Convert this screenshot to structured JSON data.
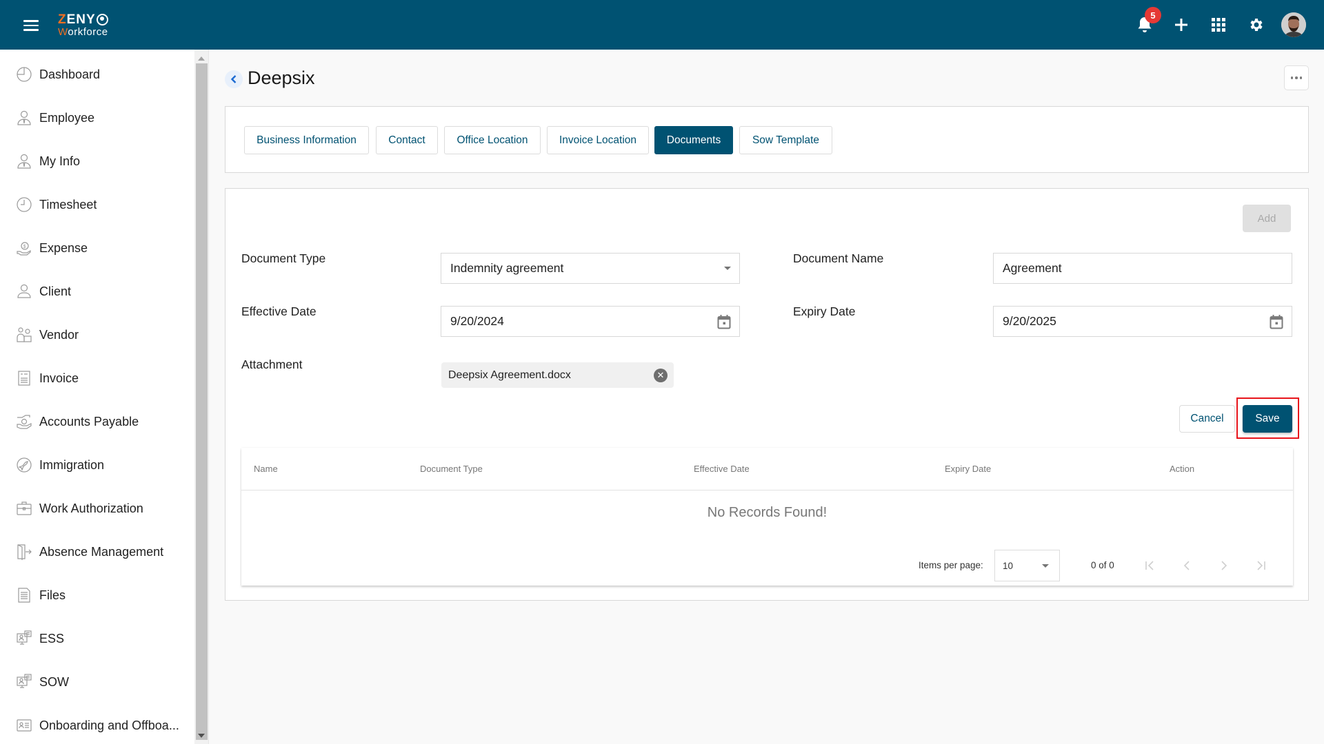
{
  "app": {
    "logo_line1_first": "Z",
    "logo_line1_rest": "ENY",
    "logo_line2_first": "W",
    "logo_line2_rest": "orkforce"
  },
  "header": {
    "notification_count": "5",
    "icons": [
      "menu-icon",
      "bell-icon",
      "plus-icon",
      "apps-grid-icon",
      "gear-icon",
      "user-avatar"
    ]
  },
  "sidebar": {
    "items": [
      {
        "label": "Dashboard",
        "icon": "dashboard-icon"
      },
      {
        "label": "Employee",
        "icon": "employee-icon"
      },
      {
        "label": "My Info",
        "icon": "my-info-icon"
      },
      {
        "label": "Timesheet",
        "icon": "clock-icon"
      },
      {
        "label": "Expense",
        "icon": "expense-icon"
      },
      {
        "label": "Client",
        "icon": "client-icon"
      },
      {
        "label": "Vendor",
        "icon": "vendor-icon"
      },
      {
        "label": "Invoice",
        "icon": "invoice-icon"
      },
      {
        "label": "Accounts Payable",
        "icon": "accounts-payable-icon"
      },
      {
        "label": "Immigration",
        "icon": "immigration-icon"
      },
      {
        "label": "Work Authorization",
        "icon": "briefcase-icon"
      },
      {
        "label": "Absence Management",
        "icon": "door-exit-icon"
      },
      {
        "label": "Files",
        "icon": "file-icon"
      },
      {
        "label": "ESS",
        "icon": "ess-icon"
      },
      {
        "label": "SOW",
        "icon": "sow-icon"
      },
      {
        "label": "Onboarding and Offboa...",
        "icon": "id-card-icon"
      }
    ]
  },
  "page": {
    "title": "Deepsix",
    "tabs": [
      {
        "label": "Business Information",
        "active": false
      },
      {
        "label": "Contact",
        "active": false
      },
      {
        "label": "Office Location",
        "active": false
      },
      {
        "label": "Invoice Location",
        "active": false
      },
      {
        "label": "Documents",
        "active": true
      },
      {
        "label": "Sow Template",
        "active": false
      }
    ]
  },
  "form": {
    "add_label": "Add",
    "document_type_label": "Document Type",
    "document_type_value": "Indemnity agreement",
    "document_name_label": "Document Name",
    "document_name_value": "Agreement",
    "effective_date_label": "Effective Date",
    "effective_date_value": "9/20/2024",
    "expiry_date_label": "Expiry Date",
    "expiry_date_value": "9/20/2025",
    "attachment_label": "Attachment",
    "attachment_file": "Deepsix Agreement.docx",
    "cancel_label": "Cancel",
    "save_label": "Save"
  },
  "table": {
    "columns": [
      "Name",
      "Document Type",
      "Effective Date",
      "Expiry Date",
      "Action"
    ],
    "rows": [],
    "empty_message": "No Records Found!",
    "paginator": {
      "items_per_page_label": "Items per page:",
      "items_per_page_value": "10",
      "range_label": "0 of 0"
    }
  },
  "colors": {
    "primary": "#005272",
    "accent_orange": "#f26f21",
    "badge_red": "#e53935",
    "highlight_red": "#e8141b"
  }
}
